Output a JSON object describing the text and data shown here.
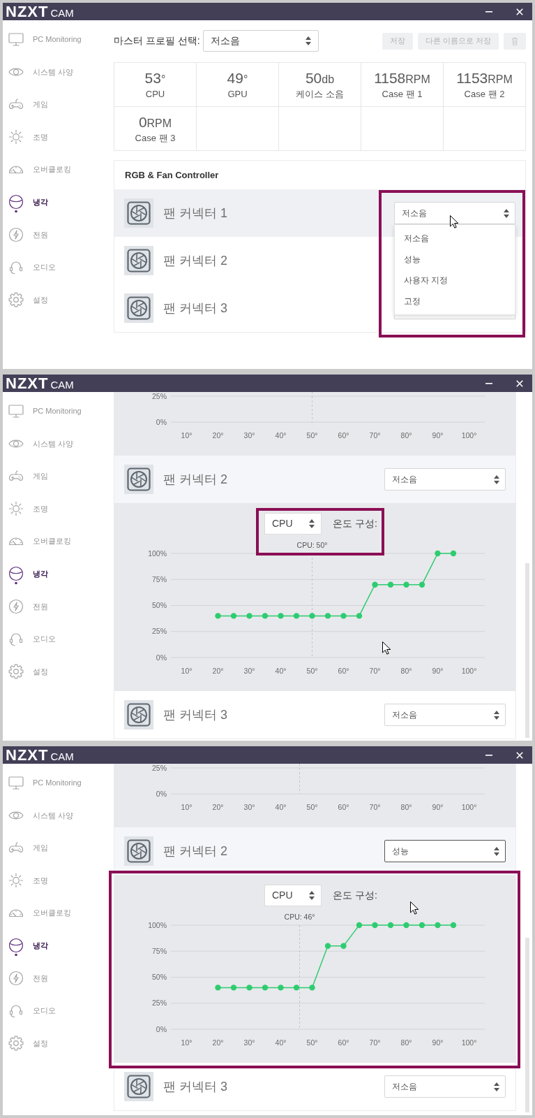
{
  "windows": [
    {
      "title_bar": {
        "logo_mark": "NZXT",
        "logo_text": "CAM"
      },
      "scrollbar": false,
      "sidebar": [
        {
          "label": "PC Monitoring",
          "selected": false
        },
        {
          "label": "시스템 사양",
          "selected": false
        },
        {
          "label": "게임",
          "selected": false
        },
        {
          "label": "조명",
          "selected": false
        },
        {
          "label": "오버클로킹",
          "selected": false
        },
        {
          "label": "냉각",
          "selected": true
        },
        {
          "label": "전원",
          "selected": false
        },
        {
          "label": "오디오",
          "selected": false
        },
        {
          "label": "설정",
          "selected": false
        }
      ],
      "profile_bar": {
        "label": "마스터 프로필 선택:",
        "select": {
          "value": "저소음"
        },
        "buttons": [
          {
            "kind": "text",
            "label": "저장",
            "disabled": true
          },
          {
            "kind": "text",
            "label": "다른 이름으로 저장",
            "disabled": true
          },
          {
            "kind": "trash",
            "disabled": true
          }
        ]
      },
      "stats": [
        {
          "value": "53",
          "unit": "°",
          "label": "CPU"
        },
        {
          "value": "49",
          "unit": "°",
          "label": "GPU"
        },
        {
          "value": "50",
          "unit": "db",
          "label": "케이스 소음"
        },
        {
          "value": "1158",
          "unit": "RPM",
          "label": "Case 팬 1"
        },
        {
          "value": "1153",
          "unit": "RPM",
          "label": "Case 팬 2"
        },
        {
          "value": "0",
          "unit": "RPM",
          "label": "Case 팬 3"
        }
      ],
      "fan_controller": {
        "title": "RGB & Fan Controller",
        "items": [
          {
            "kind": "row",
            "name": "팬 커넥터 1",
            "highlighted": true,
            "select": {
              "value": "저소음",
              "focused": false,
              "framed": true,
              "menu": [
                "저소음",
                "성능",
                "사용자 지정",
                "고정"
              ]
            }
          },
          {
            "kind": "row",
            "name": "팬 커넥터 2",
            "highlighted": false
          },
          {
            "kind": "row",
            "name": "팬 커넥터 3",
            "highlighted": false,
            "select": {
              "covered": true
            }
          }
        ]
      }
    },
    {
      "title_bar": {
        "logo_mark": "NZXT",
        "logo_text": "CAM"
      },
      "scrollbar": true,
      "sidebar": [
        {
          "label": "PC Monitoring",
          "selected": false
        },
        {
          "label": "시스템 사양",
          "selected": false
        },
        {
          "label": "게임",
          "selected": false
        },
        {
          "label": "조명",
          "selected": false
        },
        {
          "label": "오버클로킹",
          "selected": false
        },
        {
          "label": "냉각",
          "selected": true
        },
        {
          "label": "전원",
          "selected": false
        },
        {
          "label": "오디오",
          "selected": false
        },
        {
          "label": "설정",
          "selected": false
        }
      ],
      "fan_controller": {
        "items": [
          {
            "kind": "curve",
            "framed": false,
            "chart_data": {
              "type": "line",
              "xlim": [
                5,
                105
              ],
              "ylim": [
                0,
                25
              ],
              "xticks": [
                {
                  "value": 10,
                  "label": "10°"
                },
                {
                  "value": 20,
                  "label": "20°"
                },
                {
                  "value": 30,
                  "label": "30°"
                },
                {
                  "value": 40,
                  "label": "40°"
                },
                {
                  "value": 50,
                  "label": "50°"
                },
                {
                  "value": 60,
                  "label": "60°"
                },
                {
                  "value": 70,
                  "label": "70°"
                },
                {
                  "value": 80,
                  "label": "80°"
                },
                {
                  "value": 90,
                  "label": "90°"
                },
                {
                  "value": 100,
                  "label": "100°"
                }
              ],
              "yticks": [
                {
                  "value": 0,
                  "label": "0%"
                },
                {
                  "value": 25,
                  "label": "25%"
                }
              ],
              "ref_lines": [
                {
                  "axis": "x",
                  "value": 50
                }
              ]
            }
          },
          {
            "kind": "open_row",
            "name": "팬 커넥터 2",
            "select": {
              "value": "저소음",
              "focused": false
            }
          },
          {
            "kind": "curve",
            "framed": false,
            "source": {
              "value": "CPU",
              "framed": true
            },
            "caption": "온도 구성:",
            "reading": "CPU: 50°",
            "chart_data": {
              "type": "line",
              "xlim": [
                5,
                105
              ],
              "ylim": [
                0,
                100
              ],
              "grid": true,
              "x": [
                20,
                25,
                30,
                35,
                40,
                45,
                50,
                55,
                60,
                65,
                70,
                75,
                80,
                85,
                90,
                95
              ],
              "series": [
                {
                  "color": "#2ecc71",
                  "marker": "circle",
                  "values": [
                    40,
                    40,
                    40,
                    40,
                    40,
                    40,
                    40,
                    40,
                    40,
                    40,
                    70,
                    70,
                    70,
                    70,
                    100,
                    100
                  ]
                }
              ],
              "xticks": [
                {
                  "value": 10,
                  "label": "10°"
                },
                {
                  "value": 20,
                  "label": "20°"
                },
                {
                  "value": 30,
                  "label": "30°"
                },
                {
                  "value": 40,
                  "label": "40°"
                },
                {
                  "value": 50,
                  "label": "50°"
                },
                {
                  "value": 60,
                  "label": "60°"
                },
                {
                  "value": 70,
                  "label": "70°"
                },
                {
                  "value": 80,
                  "label": "80°"
                },
                {
                  "value": 90,
                  "label": "90°"
                },
                {
                  "value": 100,
                  "label": "100°"
                }
              ],
              "yticks": [
                {
                  "value": 0,
                  "label": "0%"
                },
                {
                  "value": 25,
                  "label": "25%"
                },
                {
                  "value": 50,
                  "label": "50%"
                },
                {
                  "value": 75,
                  "label": "75%"
                },
                {
                  "value": 100,
                  "label": "100%"
                }
              ],
              "ref_lines": [
                {
                  "axis": "x",
                  "value": 50
                }
              ]
            }
          },
          {
            "kind": "row",
            "name": "팬 커넥터 3",
            "highlighted": false,
            "select": {
              "value": "저소음",
              "focused": false
            }
          }
        ]
      }
    },
    {
      "title_bar": {
        "logo_mark": "NZXT",
        "logo_text": "CAM"
      },
      "scrollbar": true,
      "sidebar": [
        {
          "label": "PC Monitoring",
          "selected": false
        },
        {
          "label": "시스템 사양",
          "selected": false
        },
        {
          "label": "게임",
          "selected": false
        },
        {
          "label": "조명",
          "selected": false
        },
        {
          "label": "오버클로킹",
          "selected": false
        },
        {
          "label": "냉각",
          "selected": true
        },
        {
          "label": "전원",
          "selected": false
        },
        {
          "label": "오디오",
          "selected": false
        },
        {
          "label": "설정",
          "selected": false
        }
      ],
      "fan_controller": {
        "items": [
          {
            "kind": "curve",
            "framed": false,
            "chart_data": {
              "type": "line",
              "xlim": [
                5,
                105
              ],
              "ylim": [
                0,
                25
              ],
              "xticks": [
                {
                  "value": 10,
                  "label": "10°"
                },
                {
                  "value": 20,
                  "label": "20°"
                },
                {
                  "value": 30,
                  "label": "30°"
                },
                {
                  "value": 40,
                  "label": "40°"
                },
                {
                  "value": 50,
                  "label": "50°"
                },
                {
                  "value": 60,
                  "label": "60°"
                },
                {
                  "value": 70,
                  "label": "70°"
                },
                {
                  "value": 80,
                  "label": "80°"
                },
                {
                  "value": 90,
                  "label": "90°"
                },
                {
                  "value": 100,
                  "label": "100°"
                }
              ],
              "yticks": [
                {
                  "value": 0,
                  "label": "0%"
                },
                {
                  "value": 25,
                  "label": "25%"
                }
              ],
              "ref_lines": [
                {
                  "axis": "x",
                  "value": 46
                }
              ]
            }
          },
          {
            "kind": "open_row",
            "name": "팬 커넥터 2",
            "select": {
              "value": "성능",
              "focused": true
            }
          },
          {
            "kind": "curve",
            "framed": true,
            "source": {
              "value": "CPU",
              "framed": false
            },
            "caption": "온도 구성:",
            "reading": "CPU: 46°",
            "chart_data": {
              "type": "line",
              "xlim": [
                5,
                105
              ],
              "ylim": [
                0,
                100
              ],
              "grid": true,
              "x": [
                20,
                25,
                30,
                35,
                40,
                45,
                50,
                55,
                60,
                65,
                70,
                75,
                80,
                85,
                90,
                95
              ],
              "series": [
                {
                  "color": "#2ecc71",
                  "marker": "circle",
                  "values": [
                    40,
                    40,
                    40,
                    40,
                    40,
                    40,
                    40,
                    80,
                    80,
                    100,
                    100,
                    100,
                    100,
                    100,
                    100,
                    100
                  ]
                }
              ],
              "xticks": [
                {
                  "value": 10,
                  "label": "10°"
                },
                {
                  "value": 20,
                  "label": "20°"
                },
                {
                  "value": 30,
                  "label": "30°"
                },
                {
                  "value": 40,
                  "label": "40°"
                },
                {
                  "value": 50,
                  "label": "50°"
                },
                {
                  "value": 60,
                  "label": "60°"
                },
                {
                  "value": 70,
                  "label": "70°"
                },
                {
                  "value": 80,
                  "label": "80°"
                },
                {
                  "value": 90,
                  "label": "90°"
                },
                {
                  "value": 100,
                  "label": "100°"
                }
              ],
              "yticks": [
                {
                  "value": 0,
                  "label": "0%"
                },
                {
                  "value": 25,
                  "label": "25%"
                },
                {
                  "value": 50,
                  "label": "50%"
                },
                {
                  "value": 75,
                  "label": "75%"
                },
                {
                  "value": 100,
                  "label": "100%"
                }
              ],
              "ref_lines": [
                {
                  "axis": "x",
                  "value": 46
                }
              ]
            }
          },
          {
            "kind": "row",
            "name": "팬 커넥터 3",
            "highlighted": false,
            "select": {
              "value": "저소음",
              "focused": false
            }
          }
        ]
      }
    }
  ]
}
